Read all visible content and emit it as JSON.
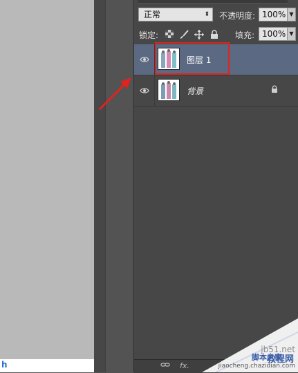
{
  "layers_panel": {
    "blend_mode": "正常",
    "opacity_label": "不透明度:",
    "opacity_value": "100%",
    "lock_label": "锁定:",
    "fill_label": "填充:",
    "fill_value": "100%",
    "layers": [
      {
        "name": "图层 1",
        "selected": true,
        "visible": true,
        "locked": false
      },
      {
        "name": "背景",
        "selected": false,
        "visible": true,
        "locked": true
      }
    ],
    "bottom_icons": [
      "link-icon",
      "fx-icon"
    ],
    "bottom_fx_label": "fx."
  },
  "canvas_badge": "h",
  "annotation_color": "#e0231f",
  "watermark": {
    "line1": "jb51.net",
    "line2": "脚本之家",
    "line3": "教程网",
    "line4": "jiaocheng.chazidian.com"
  }
}
